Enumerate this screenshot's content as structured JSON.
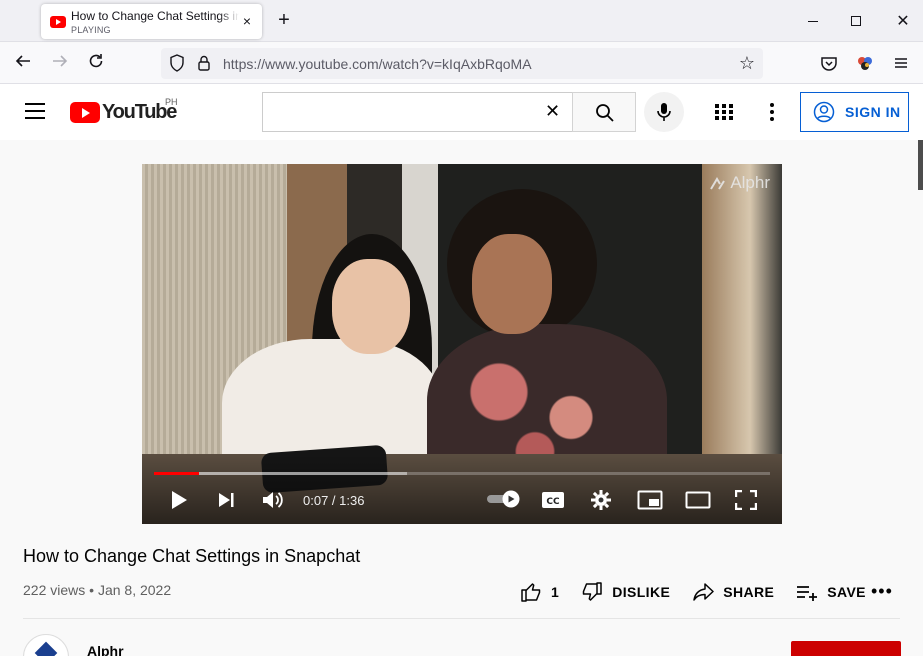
{
  "browser": {
    "tab_title": "How to Change Chat Settings in Snapchat",
    "tab_status": "PLAYING",
    "url": "https://www.youtube.com/watch?v=kIqAxbRqoMA"
  },
  "youtube": {
    "logo_text": "YouTube",
    "country_code": "PH",
    "search_value": "",
    "sign_in_label": "SIGN IN"
  },
  "player": {
    "watermark": "Alphr",
    "time_display": "0:07 / 1:36",
    "played_fraction": 0.073,
    "loaded_fraction": 0.41
  },
  "video": {
    "title": "How to Change Chat Settings in Snapchat",
    "views": "222 views",
    "separator": "•",
    "date": "Jan 8, 2022",
    "like_count": "1",
    "dislike_label": "DISLIKE",
    "share_label": "SHARE",
    "save_label": "SAVE",
    "channel_name": "Alphr"
  },
  "colors": {
    "yt_red": "#ff0000",
    "link_blue": "#065fd4",
    "progress_red": "#ff0000",
    "subscribe_red": "#cc0000"
  }
}
